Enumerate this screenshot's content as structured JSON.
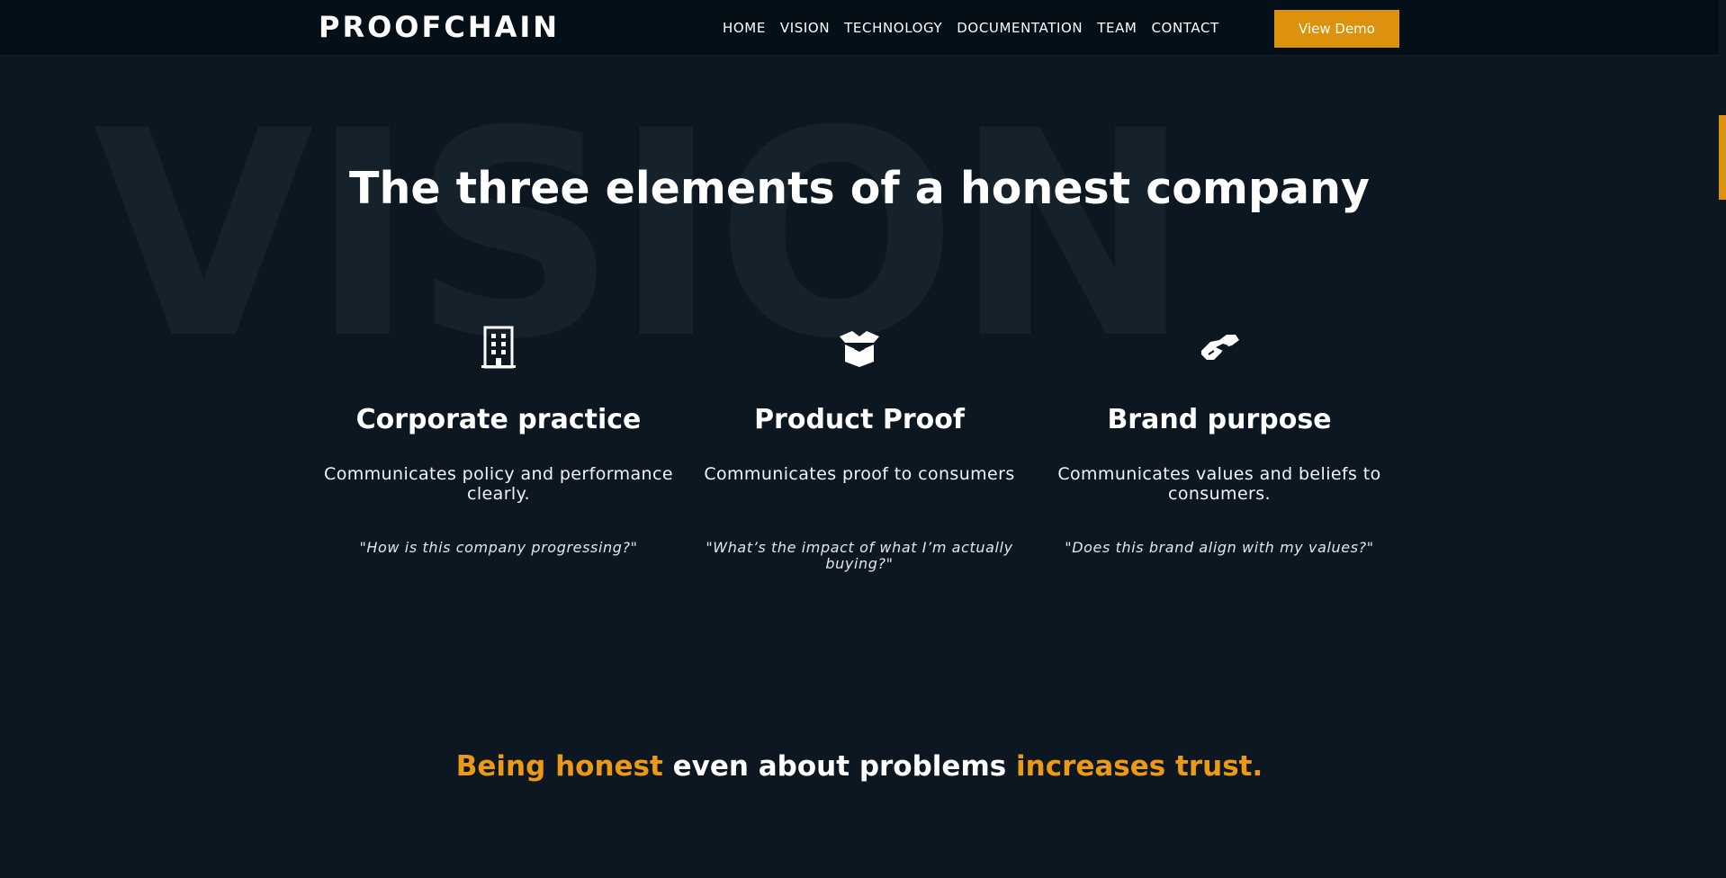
{
  "header": {
    "logo": "PROOFCHAIN",
    "nav": [
      "HOME",
      "VISION",
      "TECHNOLOGY",
      "DOCUMENTATION",
      "TEAM",
      "CONTACT"
    ],
    "cta_label": "View Demo"
  },
  "hero": {
    "background_word": "VISION",
    "title": "The three elements of a honest company"
  },
  "features": [
    {
      "icon": "building-icon",
      "title": "Corporate practice",
      "description": "Communicates policy and performance clearly.",
      "quote": "\"How is this company progressing?\""
    },
    {
      "icon": "open-box-icon",
      "title": "Product Proof",
      "description": "Communicates proof to consumers",
      "quote": "\"What’s the impact of what I’m actually buying?\""
    },
    {
      "icon": "handshake-icon",
      "title": "Brand purpose",
      "description": "Communicates values and beliefs to consumers.",
      "quote": "\"Does this brand align with my values?\""
    }
  ],
  "tagline": {
    "part1": "Being honest",
    "part2": " even about problems ",
    "part3": "increases trust."
  },
  "colors": {
    "accent": "#dc920c",
    "tagline_accent": "#ec9a16",
    "background": "#0c1721",
    "header_background": "#050f17",
    "text": "#ffffff"
  }
}
